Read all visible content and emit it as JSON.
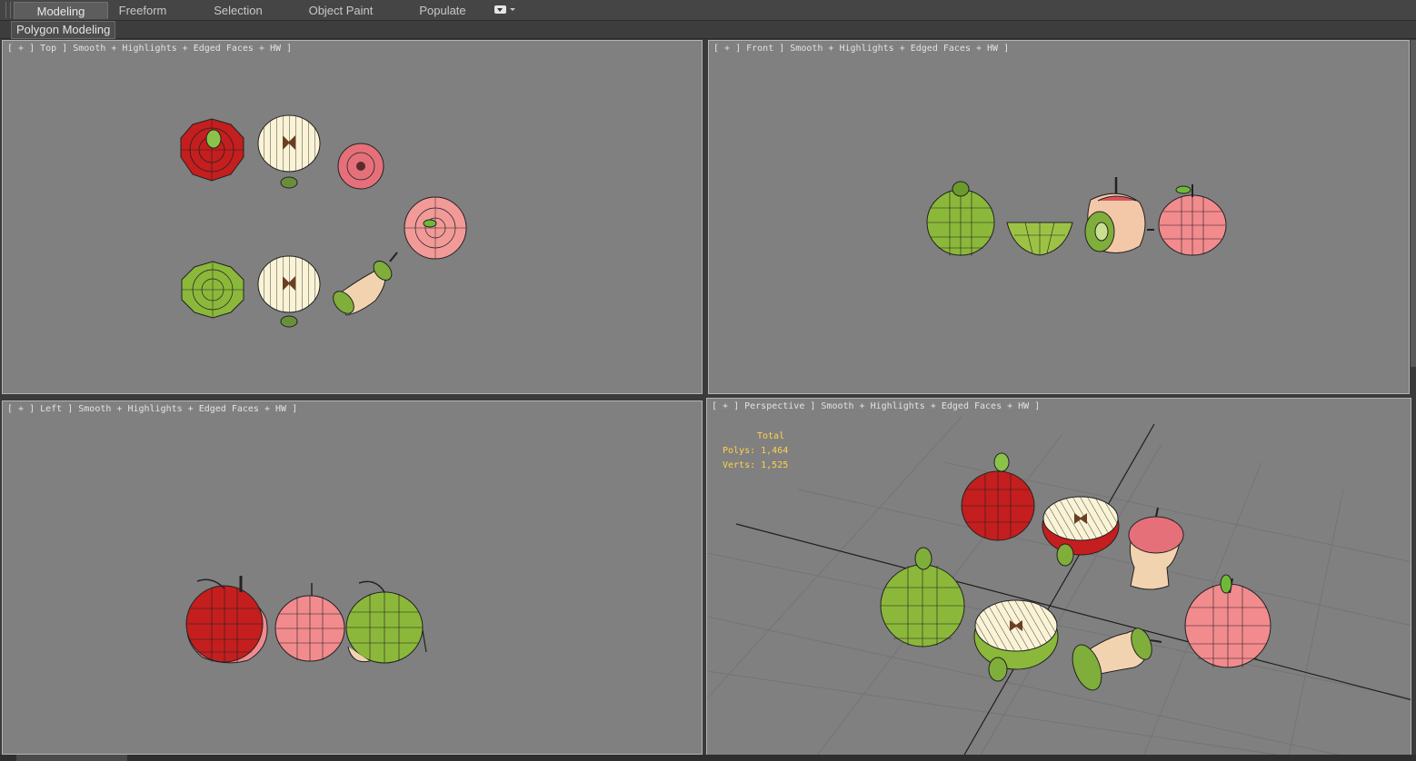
{
  "ribbon": {
    "tabs": [
      {
        "label": "Modeling",
        "active": true
      },
      {
        "label": "Freeform",
        "active": false
      },
      {
        "label": "Selection",
        "active": false
      },
      {
        "label": "Object Paint",
        "active": false
      },
      {
        "label": "Populate",
        "active": false
      }
    ],
    "panel_label": "Polygon Modeling"
  },
  "viewports": {
    "top": {
      "label": "[ + ] Top ] Smooth + Highlights + Edged Faces + HW ]"
    },
    "front": {
      "label": "[ + ] Front ] Smooth + Highlights + Edged Faces + HW ]"
    },
    "left": {
      "label": "[ + ] Left ] Smooth + Highlights + Edged Faces + HW ]"
    },
    "perspective": {
      "label": "[ + ] Perspective ] Smooth + Highlights + Edged Faces + HW ]",
      "stats": {
        "header": "Total",
        "polys": "Polys: 1,464",
        "verts": "Verts: 1,525"
      }
    }
  },
  "colors": {
    "viewport_bg": "#808080",
    "red_apple": "#c81e1e",
    "green_apple": "#8bb83a",
    "pink_apple": "#ef8a8a",
    "flesh": "#fbf3d6",
    "stats_text": "#ffd24a"
  }
}
